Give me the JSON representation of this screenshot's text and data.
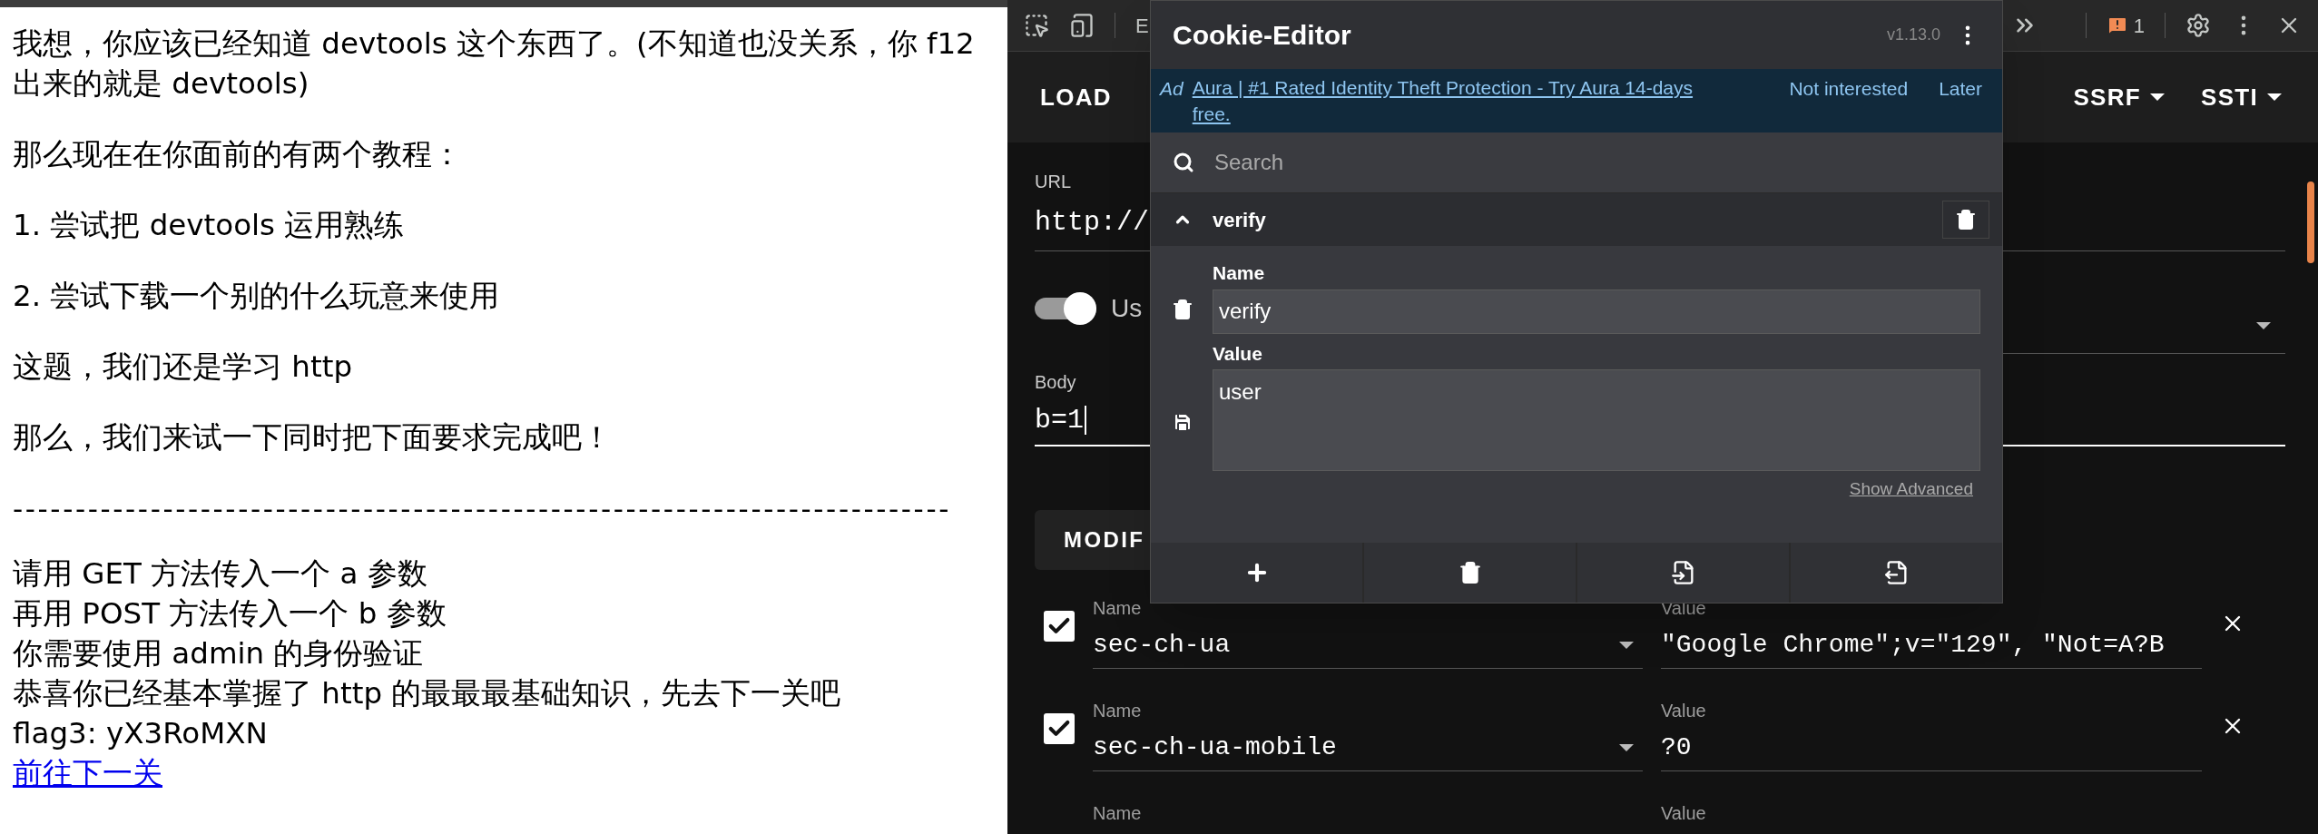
{
  "page": {
    "paragraphs": [
      "我想，你应该已经知道 devtools 这个东西了。(不知道也没关系，你 f12 出来的就是 devtools)",
      "那么现在在你面前的有两个教程：",
      "1. 尝试把 devtools 运用熟练",
      "2. 尝试下载一个别的什么玩意来使用",
      "这题，我们还是学习 http",
      "那么，我们来试一下同时把下面要求完成吧！"
    ],
    "separator": "---------------------------------------------------------------------------",
    "lines": [
      "请用 GET 方法传入一个 a 参数",
      "再用 POST 方法传入一个 b 参数",
      "你需要使用 admin 的身份验证",
      "恭喜你已经基本掌握了 http 的最最最基础知识，先去下一关吧",
      "flag3: yX3RoMXN"
    ],
    "link": "前往下一关"
  },
  "devtools": {
    "toolbar": {
      "tab": "E",
      "issues_count": "1"
    },
    "hackbar": {
      "load_button": "LOAD",
      "menus": [
        "SSRF",
        "SSTI"
      ],
      "url_label": "URL",
      "url_value": "http://",
      "toggle": {
        "label": "Us",
        "on": true
      },
      "body_label": "Body",
      "body_value": "b=1",
      "modify_button": "MODIF",
      "headers": [
        {
          "checked": true,
          "name_label": "Name",
          "name": "sec-ch-ua",
          "value_label": "Value",
          "value": "\"Google Chrome\";v=\"129\", \"Not=A?B"
        },
        {
          "checked": true,
          "name_label": "Name",
          "name": "sec-ch-ua-mobile",
          "value_label": "Value",
          "value": "?0"
        },
        {
          "name_label": "Name",
          "value_label": "Value"
        }
      ]
    }
  },
  "cookie_editor": {
    "title": "Cookie-Editor",
    "version": "v1.13.0",
    "ad": {
      "label": "Ad",
      "text": "Aura | #1 Rated Identity Theft Protection - Try Aura 14-days free.",
      "dismiss": "Not interested",
      "later": "Later"
    },
    "search": {
      "placeholder": "Search"
    },
    "cookies": [
      {
        "name": "verify",
        "expanded": true,
        "name_label": "Name",
        "name_value": "verify",
        "value_label": "Value",
        "value": "user",
        "show_advanced": "Show Advanced"
      }
    ]
  }
}
